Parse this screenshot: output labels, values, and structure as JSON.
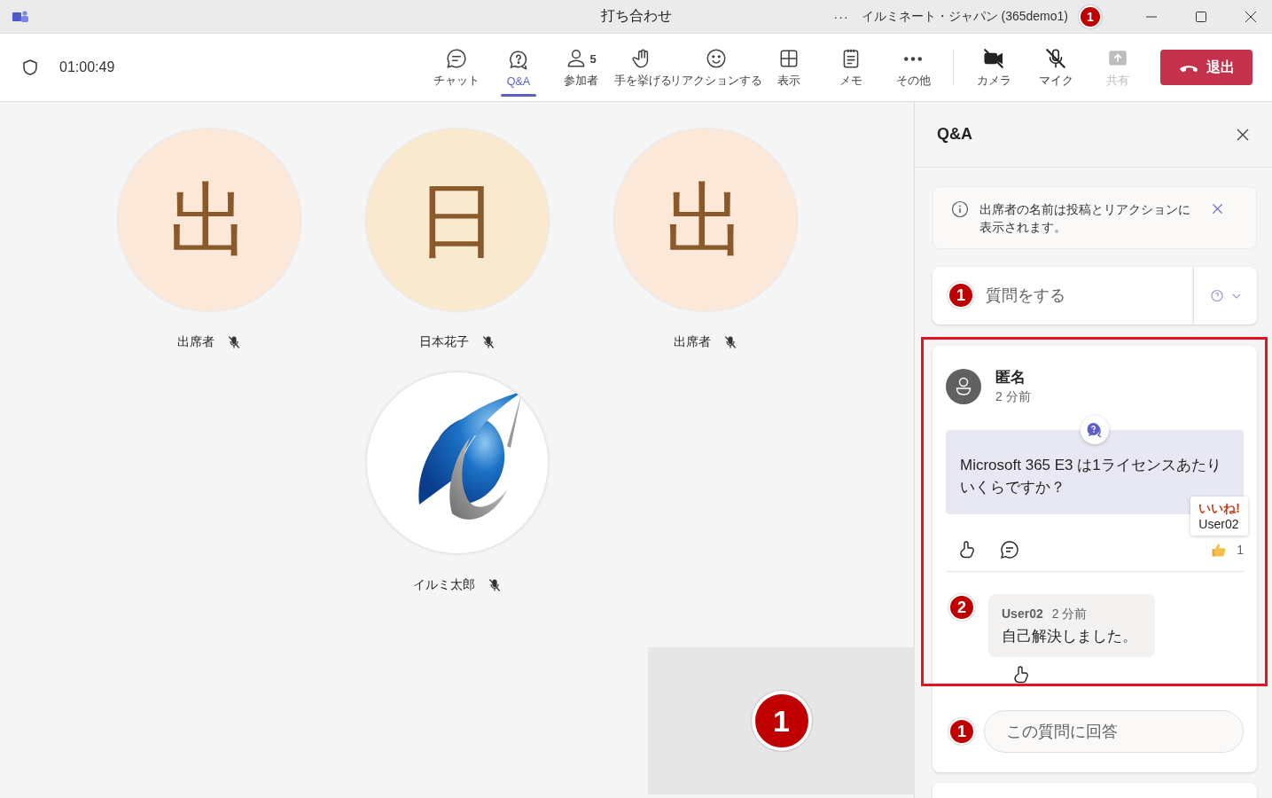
{
  "window": {
    "title": "打ち合わせ",
    "more": "···",
    "account": "イルミネート・ジャパン (365demo1)",
    "callout": "1"
  },
  "toolbar": {
    "timer": "01:00:49",
    "buttons": [
      {
        "kind": "chat",
        "label": "チャット",
        "selected": false
      },
      {
        "kind": "qa",
        "label": "Q&A",
        "selected": true
      },
      {
        "kind": "people",
        "label": "参加者",
        "count": "5",
        "selected": false
      },
      {
        "kind": "hand",
        "label": "手を挙げる",
        "selected": false
      },
      {
        "kind": "reaction",
        "label": "リアクションする",
        "selected": false
      },
      {
        "kind": "view",
        "label": "表示",
        "selected": false
      },
      {
        "kind": "notes",
        "label": "メモ",
        "selected": false
      },
      {
        "kind": "more",
        "label": "その他",
        "selected": false
      }
    ],
    "devices": [
      {
        "kind": "camera",
        "label": "カメラ",
        "on": false,
        "disabled": false
      },
      {
        "kind": "mic",
        "label": "マイク",
        "on": false,
        "disabled": false
      },
      {
        "kind": "share",
        "label": "共有",
        "disabled": true
      }
    ],
    "leave": "退出"
  },
  "participants": [
    {
      "kind": "initial",
      "initial": "出",
      "color": "#fce8d8",
      "name": "出席者",
      "muted": true
    },
    {
      "kind": "initial",
      "initial": "日",
      "color": "#f8e9cf",
      "name": "日本花子",
      "muted": true
    },
    {
      "kind": "initial",
      "initial": "出",
      "color": "#fce8d8",
      "name": "出席者",
      "muted": true
    },
    {
      "kind": "logo",
      "name": "イルミ太郎",
      "muted": true
    }
  ],
  "self_view": {
    "callout": "1"
  },
  "qa_panel": {
    "title": "Q&A",
    "notice": "出席者の名前は投稿とリアクションに表示されます。",
    "ask": {
      "placeholder": "質問をする",
      "callout": "1"
    },
    "question": {
      "author": "匿名",
      "time": "2 分前",
      "text": "Microsoft 365 E3 は1ライセンスあたりいくらですか？",
      "tooltip": {
        "title": "いいね!",
        "user": "User02"
      },
      "like_count": "1",
      "reply": {
        "callout": "2",
        "user": "User02",
        "time": "2 分前",
        "text": "自己解決しました。"
      },
      "answer": {
        "placeholder": "この質問に回答",
        "callout": "1"
      }
    }
  }
}
